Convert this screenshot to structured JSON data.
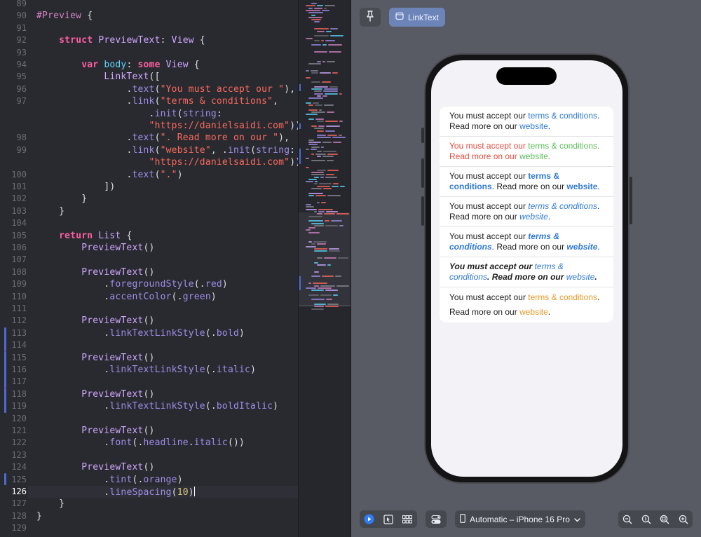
{
  "editor": {
    "current_line": 126,
    "lines": [
      {
        "n": 89,
        "text": ""
      },
      {
        "n": 90,
        "text": "#Preview {"
      },
      {
        "n": 91,
        "text": ""
      },
      {
        "n": 92,
        "text": "    struct PreviewText: View {"
      },
      {
        "n": 93,
        "text": ""
      },
      {
        "n": 94,
        "text": "        var body: some View {"
      },
      {
        "n": 95,
        "text": "            LinkText(["
      },
      {
        "n": 96,
        "text": "                .text(\"You must accept our \"),"
      },
      {
        "n": 97,
        "text": "                .link(\"terms & conditions\","
      },
      {
        "n": null,
        "text": "                    .init(string:"
      },
      {
        "n": null,
        "text": "                    \"https://danielsaidi.com\")),"
      },
      {
        "n": 98,
        "text": "                .text(\". Read more on our \"),"
      },
      {
        "n": 99,
        "text": "                .link(\"website\", .init(string:"
      },
      {
        "n": null,
        "text": "                    \"https://danielsaidi.com\")),"
      },
      {
        "n": 100,
        "text": "                .text(\".\")"
      },
      {
        "n": 101,
        "text": "            ])"
      },
      {
        "n": 102,
        "text": "        }"
      },
      {
        "n": 103,
        "text": "    }"
      },
      {
        "n": 104,
        "text": ""
      },
      {
        "n": 105,
        "text": "    return List {"
      },
      {
        "n": 106,
        "text": "        PreviewText()"
      },
      {
        "n": 107,
        "text": ""
      },
      {
        "n": 108,
        "text": "        PreviewText()"
      },
      {
        "n": 109,
        "text": "            .foregroundStyle(.red)"
      },
      {
        "n": 110,
        "text": "            .accentColor(.green)"
      },
      {
        "n": 111,
        "text": ""
      },
      {
        "n": 112,
        "text": "        PreviewText()"
      },
      {
        "n": 113,
        "text": "            .linkTextLinkStyle(.bold)"
      },
      {
        "n": 114,
        "text": ""
      },
      {
        "n": 115,
        "text": "        PreviewText()"
      },
      {
        "n": 116,
        "text": "            .linkTextLinkStyle(.italic)"
      },
      {
        "n": 117,
        "text": ""
      },
      {
        "n": 118,
        "text": "        PreviewText()"
      },
      {
        "n": 119,
        "text": "            .linkTextLinkStyle(.boldItalic)"
      },
      {
        "n": 120,
        "text": ""
      },
      {
        "n": 121,
        "text": "        PreviewText()"
      },
      {
        "n": 122,
        "text": "            .font(.headline.italic())"
      },
      {
        "n": 123,
        "text": ""
      },
      {
        "n": 124,
        "text": "        PreviewText()"
      },
      {
        "n": 125,
        "text": "            .tint(.orange)"
      },
      {
        "n": 126,
        "text": "            .lineSpacing(10)"
      },
      {
        "n": 127,
        "text": "    }"
      },
      {
        "n": 128,
        "text": "}"
      },
      {
        "n": 129,
        "text": ""
      }
    ]
  },
  "preview": {
    "pin_icon": "pin-icon",
    "variant_label": "LinkText",
    "rows": [
      {
        "style": "default",
        "t1": "You must accept our ",
        "l1": "terms & conditions",
        "t2": ". Read more on our ",
        "l2": "website",
        "t3": "."
      },
      {
        "style": "red-green",
        "t1": "You must accept our ",
        "l1": "terms & conditions",
        "t2": ". Read more on our ",
        "l2": "website",
        "t3": "."
      },
      {
        "style": "bold",
        "t1": "You must accept our ",
        "l1": "terms & conditions",
        "t2": ". Read more on our ",
        "l2": "website",
        "t3": "."
      },
      {
        "style": "italic",
        "t1": "You must accept our ",
        "l1": "terms & conditions",
        "t2": ". Read more on our ",
        "l2": "website",
        "t3": "."
      },
      {
        "style": "boldItalic",
        "t1": "You must accept our ",
        "l1": "terms & conditions",
        "t2": ". Read more on our ",
        "l2": "website",
        "t3": "."
      },
      {
        "style": "headline",
        "t1": "You must accept our ",
        "l1": "terms & conditions",
        "t2": ". Read more on our ",
        "l2": "website",
        "t3": "."
      },
      {
        "style": "orange",
        "t1": "You must accept our ",
        "l1": "terms & conditions",
        "t2": ". Read more on our ",
        "l2": "website",
        "t3": "."
      }
    ]
  },
  "bottom_bar": {
    "device_label": "Automatic – iPhone 16 Pro"
  },
  "colors": {
    "link_blue": "#2f79d8",
    "red": "#ea4b3f",
    "green": "#5cbd59",
    "orange": "#e79a28",
    "accent_button": "#6c84b8"
  }
}
